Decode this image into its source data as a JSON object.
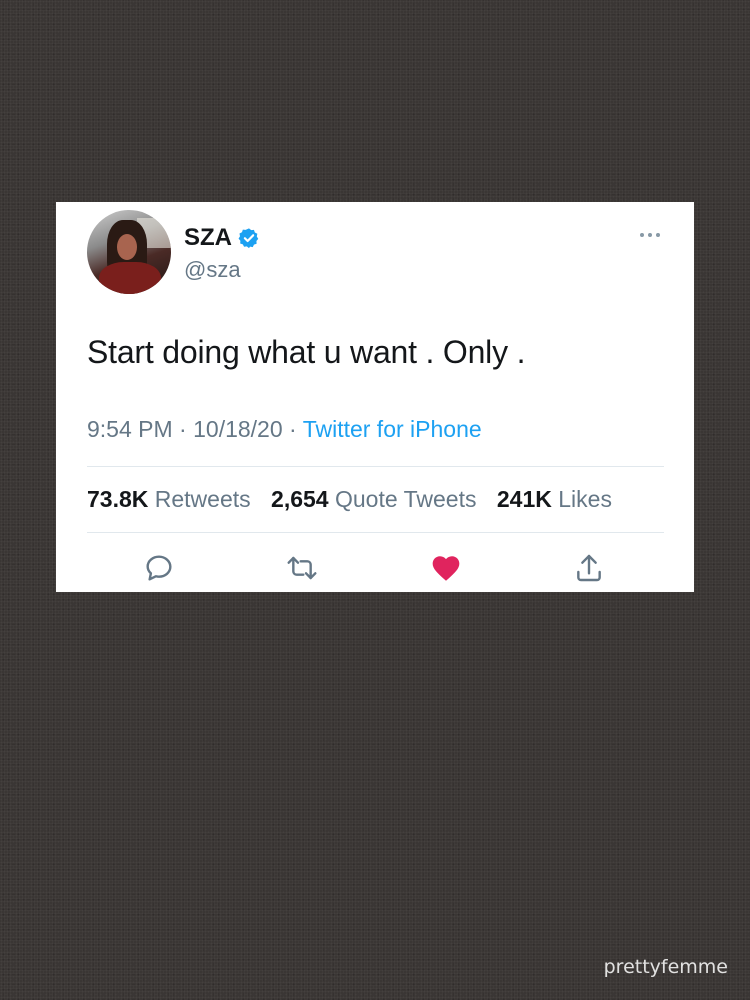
{
  "tweet": {
    "display_name": "SZA",
    "handle": "@sza",
    "text": "Start doing what u want . Only .",
    "time": "9:54 PM",
    "date": "10/18/20",
    "separator": "·",
    "source": "Twitter for iPhone",
    "verified": true
  },
  "stats": {
    "retweets_count": "73.8K",
    "retweets_label": "Retweets",
    "quotes_count": "2,654",
    "quotes_label": "Quote Tweets",
    "likes_count": "241K",
    "likes_label": "Likes"
  },
  "actions": [
    "reply-icon",
    "retweet-icon",
    "like-icon",
    "share-icon"
  ],
  "colors": {
    "verified": "#1da1f2",
    "link": "#1da1f2",
    "like": "#e0245e",
    "secondary_text": "#657786"
  },
  "watermark": "prettyfemme"
}
